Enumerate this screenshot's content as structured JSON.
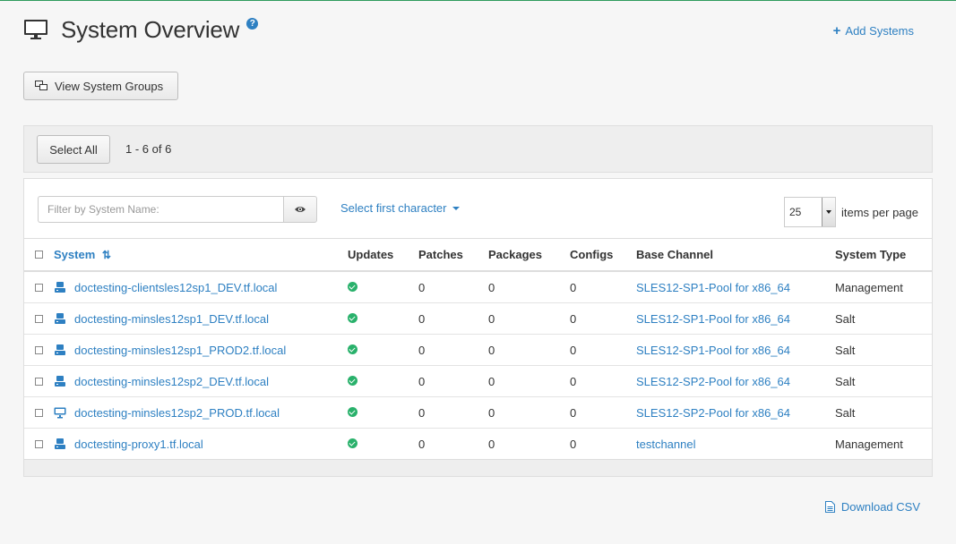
{
  "header": {
    "title": "System Overview",
    "help_icon": "question-circle-icon",
    "add_systems_label": "Add Systems"
  },
  "toolbar": {
    "view_groups_label": "View System Groups",
    "select_all_label": "Select All",
    "range_text": "1 - 6 of 6"
  },
  "filter": {
    "placeholder": "Filter by System Name:",
    "first_char_label": "Select first character",
    "items_per_page_value": "25",
    "items_per_page_label": "items per page"
  },
  "table": {
    "columns": [
      "System",
      "Updates",
      "Patches",
      "Packages",
      "Configs",
      "Base Channel",
      "System Type"
    ],
    "rows": [
      {
        "system": "doctesting-clientsles12sp1_DEV.tf.local",
        "icon": "server-icon",
        "updates": "ok-icon",
        "patches": "0",
        "packages": "0",
        "configs": "0",
        "channel": "SLES12-SP1-Pool for x86_64",
        "type": "Management"
      },
      {
        "system": "doctesting-minsles12sp1_DEV.tf.local",
        "icon": "server-icon",
        "updates": "ok-icon",
        "patches": "0",
        "packages": "0",
        "configs": "0",
        "channel": "SLES12-SP1-Pool for x86_64",
        "type": "Salt"
      },
      {
        "system": "doctesting-minsles12sp1_PROD2.tf.local",
        "icon": "server-icon",
        "updates": "ok-icon",
        "patches": "0",
        "packages": "0",
        "configs": "0",
        "channel": "SLES12-SP1-Pool for x86_64",
        "type": "Salt"
      },
      {
        "system": "doctesting-minsles12sp2_DEV.tf.local",
        "icon": "server-icon",
        "updates": "ok-icon",
        "patches": "0",
        "packages": "0",
        "configs": "0",
        "channel": "SLES12-SP2-Pool for x86_64",
        "type": "Salt"
      },
      {
        "system": "doctesting-minsles12sp2_PROD.tf.local",
        "icon": "desktop-icon",
        "updates": "ok-icon",
        "patches": "0",
        "packages": "0",
        "configs": "0",
        "channel": "SLES12-SP2-Pool for x86_64",
        "type": "Salt"
      },
      {
        "system": "doctesting-proxy1.tf.local",
        "icon": "server-icon",
        "updates": "ok-icon",
        "patches": "0",
        "packages": "0",
        "configs": "0",
        "channel": "testchannel",
        "type": "Management"
      }
    ]
  },
  "footer": {
    "download_csv_label": "Download CSV"
  },
  "colors": {
    "link": "#2e80c2",
    "ok": "#29b16b",
    "top_border": "#2f9b5d"
  }
}
